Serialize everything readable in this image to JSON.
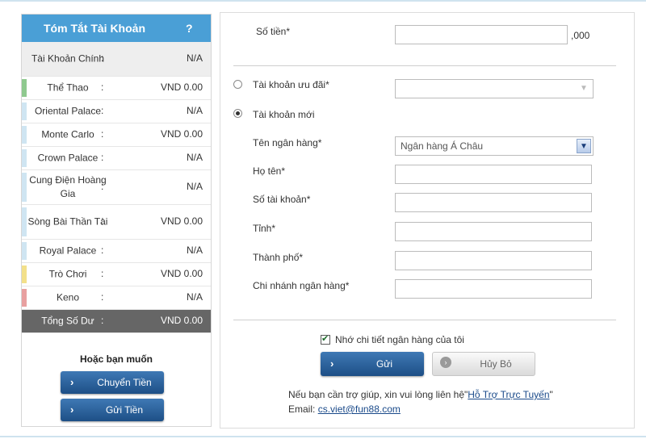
{
  "sidebar": {
    "title": "Tóm Tắt Tài Khoản",
    "help": "?",
    "accounts": [
      {
        "name": "Tài Khoản Chính",
        "value": "N/A",
        "color": "",
        "highlight": true
      },
      {
        "name": "Thể Thao",
        "value": "VND 0.00",
        "color": "#8fc98f"
      },
      {
        "name": "Oriental Palace",
        "value": "N/A",
        "color": "#cfe5f2"
      },
      {
        "name": "Monte Carlo",
        "value": "VND 0.00",
        "color": "#cfe5f2"
      },
      {
        "name": "Crown Palace",
        "value": "N/A",
        "color": "#cfe5f2"
      },
      {
        "name": "Cung Điện Hoàng Gia",
        "value": "N/A",
        "color": "#cfe5f2"
      },
      {
        "name": "Sòng Bài Thần Tài",
        "value": "VND 0.00",
        "color": "#cfe5f2"
      },
      {
        "name": "Royal Palace",
        "value": "N/A",
        "color": "#cfe5f2"
      },
      {
        "name": "Trò Chơi",
        "value": "VND 0.00",
        "color": "#f3e08a"
      },
      {
        "name": "Keno",
        "value": "N/A",
        "color": "#e8a0a0"
      }
    ],
    "total": {
      "name": "Tổng Số Dư",
      "value": "VND 0.00"
    },
    "colon": ":",
    "footer_title": "Hoặc bạn muốn",
    "transfer_button": "Chuyển Tiền",
    "deposit_button": "Gửi Tiền"
  },
  "form": {
    "amount_label": "Số tiền*",
    "amount_value": "",
    "amount_suffix": ",000",
    "preferred_account_label": "Tài khoản ưu đãi*",
    "preferred_account_value": "",
    "new_account_label": "Tài khoản mới",
    "bank_name_label": "Tên ngân hàng*",
    "bank_name_value": "Ngân hàng Á Châu",
    "full_name_label": "Họ tên*",
    "account_number_label": "Số tài khoản*",
    "province_label": "Tỉnh*",
    "city_label": "Thành phố*",
    "branch_label": "Chi nhánh ngân hàng*",
    "remember_label": "Nhớ chi tiết ngân hàng của tôi",
    "remember_checked": true,
    "submit_button": "Gửi",
    "cancel_button": "Hủy Bỏ",
    "help_text_prefix": "Nếu bạn cần trợ giúp, xin vui lòng liên hệ\"",
    "help_link": "Hỗ Trợ Trực Tuyến",
    "help_text_suffix": "\"",
    "email_label": "Email:",
    "email_link": "cs.viet@fun88.com"
  },
  "colors": {
    "header_blue": "#4a9fd6",
    "button_blue": "#1d4f86",
    "total_bg": "#666666"
  }
}
